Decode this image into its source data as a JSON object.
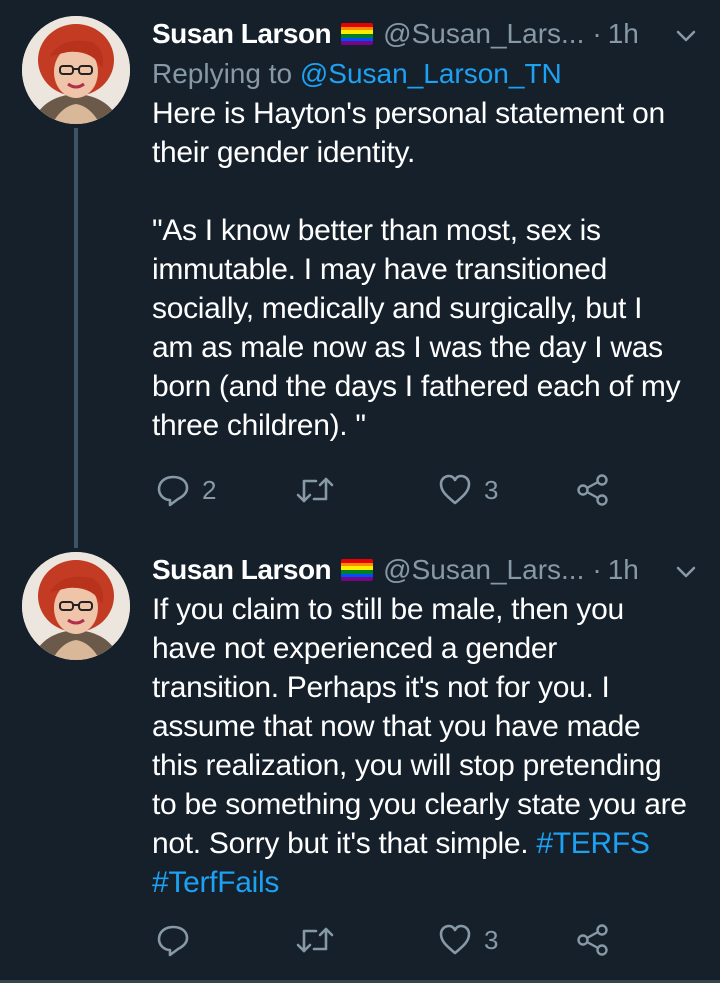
{
  "tweets": [
    {
      "author_name": "Susan Larson",
      "handle": "@Susan_Lars...",
      "separator": "·",
      "time": "1h",
      "replying_prefix": "Replying to",
      "replying_to": "@Susan_Larson_TN",
      "body_lines_a": [
        "Here is Hayton's personal statement on",
        "their gender identity."
      ],
      "body_lines_b": [
        "\"As I know better than most, sex is",
        "immutable. I may have transitioned",
        "socially, medically and surgically, but I",
        "am as male now as I was the day I was",
        "born (and the days I fathered each of my",
        "three children). \""
      ],
      "reply_count": "2",
      "retweet_count": "",
      "like_count": "3"
    },
    {
      "author_name": "Susan Larson",
      "handle": "@Susan_Lars...",
      "separator": "·",
      "time": "1h",
      "body_lines": [
        "If you claim to still be male, then you",
        "have not experienced a gender",
        "transition. Perhaps it's not for you. I",
        "assume that now that you have made",
        "this realization, you will stop pretending",
        "to be something you clearly state you are"
      ],
      "body_last_line": "not. Sorry but it's that simple.",
      "hashtag_1": "#TERFS",
      "hashtag_2": "#TerfFails",
      "reply_count": "",
      "retweet_count": "",
      "like_count": "3"
    }
  ],
  "colors": {
    "background": "#15202b",
    "text": "#ffffff",
    "secondary": "#8899a6",
    "link": "#1da1f2",
    "thread_line": "#3d5466"
  },
  "icons": [
    "reply-icon",
    "retweet-icon",
    "like-icon",
    "share-icon",
    "chevron-down-icon",
    "rainbow-flag-icon",
    "avatar"
  ]
}
